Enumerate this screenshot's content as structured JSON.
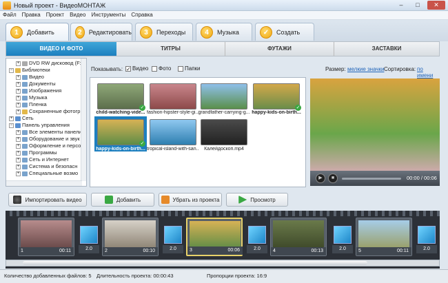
{
  "window": {
    "title": "Новый проект - ВидеоМОНТАЖ",
    "min": "–",
    "max": "□",
    "close": "✕"
  },
  "menu": [
    "Файл",
    "Правка",
    "Проект",
    "Видео",
    "Инструменты",
    "Справка"
  ],
  "steps": [
    {
      "num": "1",
      "label": "Добавить"
    },
    {
      "num": "2",
      "label": "Редактировать"
    },
    {
      "num": "3",
      "label": "Переходы"
    },
    {
      "num": "4",
      "label": "Музыка"
    },
    {
      "num": "✓",
      "label": "Создать"
    }
  ],
  "tabs": [
    "ВИДЕО И ФОТО",
    "ТИТРЫ",
    "ФУТАЖИ",
    "ЗАСТАВКИ"
  ],
  "tree": [
    "DVD RW дисковод (F:)",
    "Библиотеки",
    "Видео",
    "Документы",
    "Изображения",
    "Музыка",
    "Пленка",
    "Сохраненные фотогр",
    "Сеть",
    "Панель управления",
    "Все элементы панели",
    "Оборудование и звук",
    "Оформление и персо",
    "Программы",
    "Сеть и Интернет",
    "Система и безопасн",
    "Специальные возмо"
  ],
  "filter": {
    "show": "Показывать:",
    "video": "Видео",
    "photo": "Фото",
    "folders": "Папки",
    "size": "Размер:",
    "size_val": "мелкие значки",
    "sort": "Сортировка:",
    "sort_val": "по имени"
  },
  "files": [
    "child-watching-vide...",
    "fashion-hipster-style-gi...",
    "grandfather-carrying-g...",
    "happy-kids-on-birth...",
    "happy-kids-on-birth...",
    "tropical-island-with-san...",
    "Калейдоскоп.mp4"
  ],
  "player": {
    "time": "00:00 / 00:06"
  },
  "actions": [
    "Импортировать видео",
    "Добавить",
    "Убрать из проекта",
    "Просмотр"
  ],
  "timeline": [
    {
      "n": "1",
      "d": "00:11"
    },
    {
      "n": "2",
      "d": "00:10"
    },
    {
      "n": "3",
      "d": "00:06"
    },
    {
      "n": "4",
      "d": "00:13"
    },
    {
      "n": "5",
      "d": "00:11"
    }
  ],
  "transitions": [
    "2.0",
    "2.0",
    "2.0",
    "2.0",
    "2.0"
  ],
  "status": {
    "files": "Количество добавленных файлов: 5",
    "duration": "Длительность проекта: 00:00:43",
    "ratio": "Пропорции проекта: 16:9"
  }
}
